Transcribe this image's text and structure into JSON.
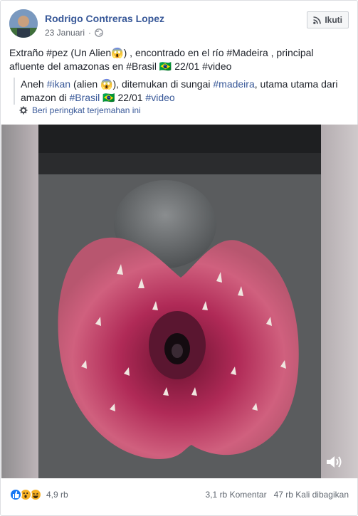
{
  "post": {
    "author": "Rodrigo Contreras Lopez",
    "date": "23 Januari",
    "privacy_sep": "·",
    "follow_label": "Ikuti",
    "text_es": "Extraño #pez (Un Alien😱) , encontrado en el río #Madeira , principal afluente del amazonas en #Brasil 🇧🇷 22/01 #video",
    "translation": {
      "part1": "Aneh ",
      "tag_ikan": "#ikan",
      "part2": " (alien 😱), ditemukan di sungai ",
      "tag_madeira": "#madeira",
      "part3": ", utama utama dari amazon di ",
      "tag_brasil": "#Brasil",
      "part4": " 🇧🇷 22/01 ",
      "tag_video": "#video"
    },
    "rate_translation_label": "Beri peringkat terjemahan ini"
  },
  "footer": {
    "reaction_count": "4,9 rb",
    "comments": "3,1 rb Komentar",
    "shares": "47 rb Kali dibagikan"
  },
  "colors": {
    "link": "#385898",
    "like": "#1877f2",
    "wow": "#f7b125"
  },
  "icons": [
    "globe-icon",
    "rss-icon",
    "gear-icon",
    "speaker-icon",
    "like-reaction-icon",
    "wow-reaction-icon",
    "haha-reaction-icon"
  ]
}
